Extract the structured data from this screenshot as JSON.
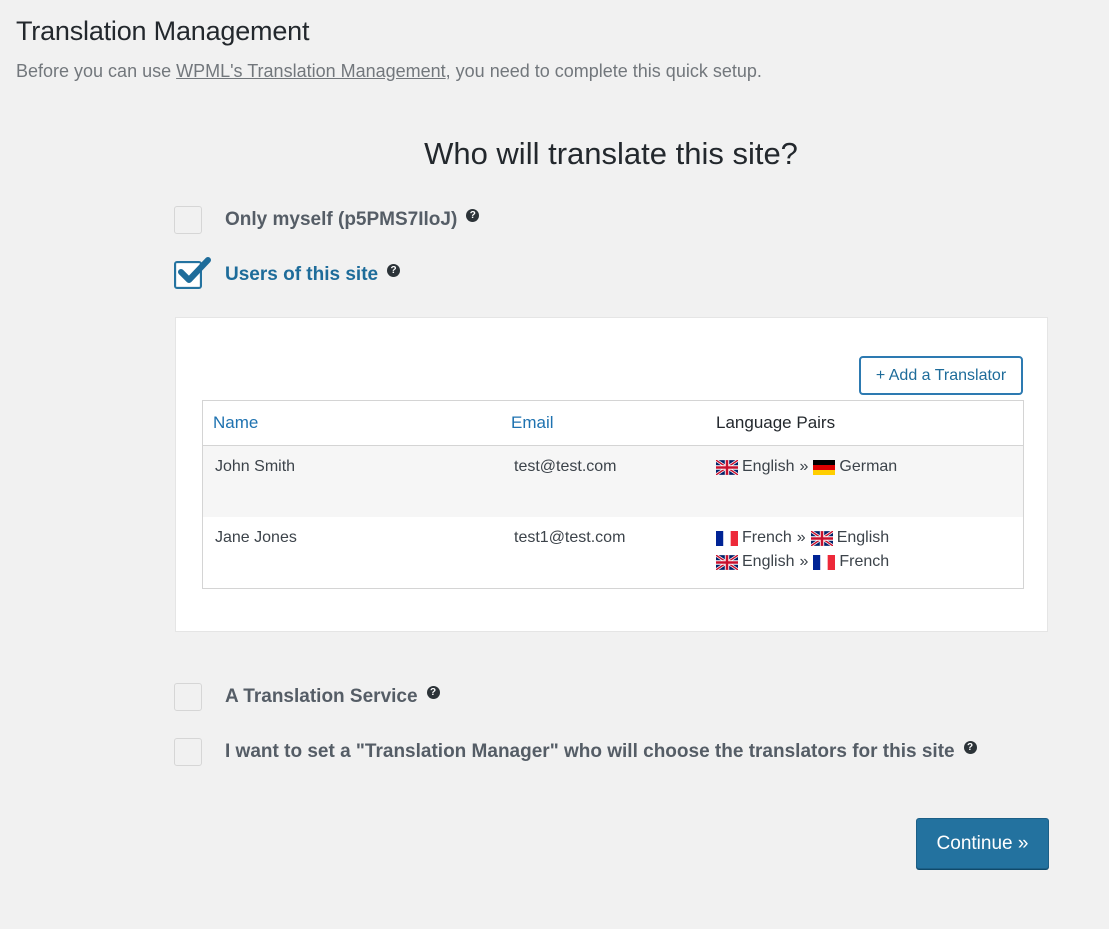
{
  "page": {
    "title": "Translation Management",
    "intro_before": "Before you can use ",
    "intro_link": "WPML's Translation Management",
    "intro_after": ", you need to complete this quick setup."
  },
  "question": "Who will translate this site?",
  "options": [
    {
      "label": "Only myself (p5PMS7IloJ)",
      "checked": false
    },
    {
      "label": "Users of this site",
      "checked": true
    },
    {
      "label": "A Translation Service",
      "checked": false
    },
    {
      "label": "I want to set a \"Translation Manager\" who will choose the translators for this site",
      "checked": false
    }
  ],
  "help_glyph": "?",
  "translators": {
    "add_button": "+ Add a Translator",
    "columns": [
      "Name",
      "Email",
      "Language Pairs"
    ],
    "rows": [
      {
        "name": "John Smith",
        "email": "test@test.com",
        "pairs": [
          {
            "from": "English",
            "from_flag": "uk-flag-icon",
            "sep": "»",
            "to": "German",
            "to_flag": "de-flag-icon"
          }
        ]
      },
      {
        "name": "Jane Jones",
        "email": "test1@test.com",
        "pairs": [
          {
            "from": "French",
            "from_flag": "fr-flag-icon",
            "sep": "»",
            "to": "English",
            "to_flag": "uk-flag-icon"
          },
          {
            "from": "English",
            "from_flag": "uk-flag-icon",
            "sep": "»",
            "to": "French",
            "to_flag": "fr-flag-icon"
          }
        ]
      }
    ]
  },
  "continue_label": "Continue »",
  "colors": {
    "accent": "#23729f",
    "link": "#1e72b0",
    "background": "#f1f1f1"
  }
}
